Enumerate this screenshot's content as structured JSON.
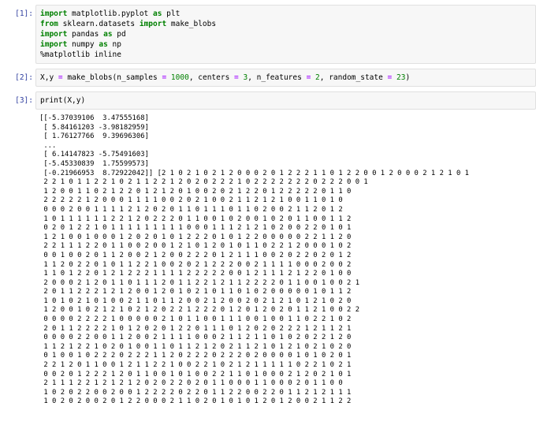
{
  "cells": [
    {
      "prompt": "[1]:",
      "lines": [
        [
          [
            "kw",
            "import"
          ],
          [
            "fn",
            " matplotlib.pyplot "
          ],
          [
            "kw",
            "as"
          ],
          [
            "fn",
            " plt"
          ]
        ],
        [
          [
            "kw",
            "from"
          ],
          [
            "fn",
            " sklearn.datasets "
          ],
          [
            "kw",
            "import"
          ],
          [
            "fn",
            " make_blobs"
          ]
        ],
        [
          [
            "kw",
            "import"
          ],
          [
            "fn",
            " pandas "
          ],
          [
            "kw",
            "as"
          ],
          [
            "fn",
            " pd"
          ]
        ],
        [
          [
            "kw",
            "import"
          ],
          [
            "fn",
            " numpy "
          ],
          [
            "kw",
            "as"
          ],
          [
            "fn",
            " np"
          ]
        ],
        [
          [
            "mag",
            "%matplotlib inline"
          ]
        ]
      ]
    },
    {
      "prompt": "[2]:",
      "lines": [
        [
          [
            "fn",
            "X,y "
          ],
          [
            "op",
            "="
          ],
          [
            "fn",
            " make_blobs(n_samples "
          ],
          [
            "op",
            "="
          ],
          [
            "num",
            " 1000"
          ],
          [
            "fn",
            ", centers "
          ],
          [
            "op",
            "="
          ],
          [
            "num",
            " 3"
          ],
          [
            "fn",
            ", n_features "
          ],
          [
            "op",
            "="
          ],
          [
            "num",
            " 2"
          ],
          [
            "fn",
            ", random_state "
          ],
          [
            "op",
            "="
          ],
          [
            "num",
            " 23"
          ],
          [
            "fn",
            ")"
          ]
        ]
      ]
    },
    {
      "prompt": "[3]:",
      "lines": [
        [
          [
            "fn",
            "print(X,y)"
          ]
        ]
      ]
    }
  ],
  "output_lines": [
    "[[-5.37039106  3.47555168]",
    " [ 5.84161203 -3.98182959]",
    " [ 1.76127766  9.39696306]",
    " ...",
    " [ 6.14147823 -5.75491603]",
    " [-5.45330839  1.75599573]",
    " [-0.21966953  8.72922042]] [2 1 0 2 1 0 2 1 2 0 0 0 2 0 1 2 2 2 1 1 0 1 2 2 0 0 1 2 0 0 0 2 1 2 1 0 1",
    " 2 2 1 0 1 1 2 2 1 0 2 1 1 2 2 1 2 0 2 0 2 2 2 1 0 2 2 2 2 2 2 2 0 2 2 2 0 0 1",
    " 1 2 0 0 1 1 0 2 1 2 2 0 1 2 1 2 0 1 0 0 2 0 2 1 2 2 0 1 2 2 2 2 2 0 1 1 0",
    " 2 2 2 2 2 1 2 0 0 0 1 1 1 1 0 0 2 0 2 1 0 0 2 1 1 2 1 2 1 0 0 1 1 0 1 0",
    " 0 0 0 2 0 0 1 1 1 1 2 1 2 0 2 0 1 1 0 1 1 1 0 1 1 0 2 0 0 2 1 1 2 0 1 2",
    " 1 0 1 1 1 1 1 1 2 2 1 2 0 2 2 2 0 1 1 0 0 1 0 2 0 0 1 0 2 0 1 1 0 0 1 1 2",
    " 0 2 0 1 2 2 1 0 1 1 1 1 1 1 1 1 1 0 0 0 1 1 1 2 1 2 1 0 2 0 0 2 2 0 1 0 1",
    " 1 2 1 0 0 1 0 0 0 1 2 0 2 0 1 0 1 2 2 2 0 1 0 1 2 2 0 0 0 0 0 2 2 1 1 2 0",
    " 2 2 1 1 1 2 2 0 1 1 0 0 2 0 0 1 2 1 0 1 2 0 1 0 1 1 0 2 2 1 2 0 0 0 1 0 2",
    " 0 0 1 0 0 2 0 1 1 2 0 0 2 1 2 0 0 2 2 2 0 1 2 1 1 1 0 0 2 0 2 2 0 2 0 1 2",
    " 1 1 2 0 2 2 0 1 0 1 1 2 2 1 0 0 2 0 2 1 2 2 2 0 0 2 1 1 1 1 0 0 0 2 0 0 2",
    " 1 1 0 1 2 2 0 1 2 1 2 2 2 1 1 1 1 2 2 2 2 2 0 0 1 2 1 1 1 2 1 2 2 0 1 0 0",
    " 2 0 0 0 2 1 2 0 1 1 0 1 1 1 2 0 1 1 2 2 1 2 1 1 2 2 2 2 0 1 1 0 0 1 0 0 2 1",
    " 2 0 1 1 2 2 2 1 2 1 2 0 0 1 2 0 1 0 2 1 0 1 1 0 1 0 2 0 0 0 0 0 1 0 1 1 2",
    " 1 0 1 0 2 1 0 1 0 0 2 1 1 0 1 1 2 0 0 2 1 2 0 0 2 0 2 1 2 1 0 1 2 1 0 2 0",
    " 1 2 0 0 1 0 2 1 2 1 0 2 1 2 0 2 2 1 2 2 2 0 1 2 0 1 2 0 2 0 1 1 2 1 0 0 2 2",
    " 0 0 0 0 2 2 2 2 1 0 0 0 0 0 2 1 0 1 1 0 0 1 1 1 0 0 1 0 0 1 1 0 2 2 1 0 2",
    " 2 0 1 1 2 2 2 2 1 0 1 2 0 2 0 1 2 2 0 1 1 1 0 1 2 0 2 0 2 2 2 1 2 1 1 2 1",
    " 0 0 0 0 2 2 0 0 1 1 2 0 0 2 1 1 1 1 0 0 0 2 1 1 2 1 1 0 1 0 2 0 2 2 1 2 0",
    " 1 1 2 1 2 2 1 0 2 0 1 0 0 1 1 0 1 1 2 1 2 0 2 1 1 2 1 0 1 2 1 0 2 1 0 2 0",
    " 0 1 0 0 1 0 2 2 2 0 2 2 2 1 1 2 0 2 2 2 0 2 2 2 0 2 0 0 0 0 1 0 1 0 2 0 1",
    " 2 2 1 2 0 1 1 0 0 1 2 1 1 2 2 1 0 0 2 2 1 0 2 1 2 1 1 1 1 1 0 2 2 1 0 2 1",
    " 0 0 2 0 1 2 2 2 1 2 0 1 1 0 0 1 0 1 0 0 2 2 1 1 0 1 0 0 0 2 1 2 0 2 1 0 1",
    " 2 1 1 1 2 2 1 2 1 2 1 2 0 2 0 2 2 0 2 0 1 1 0 0 0 1 1 0 0 0 2 0 1 1 0 0",
    " 1 0 2 0 2 2 0 0 2 0 0 1 2 2 2 2 0 2 2 0 1 1 2 2 0 0 2 2 0 1 1 2 1 2 1 1 1",
    " 1 0 2 0 2 0 0 2 0 1 2 2 0 0 0 2 1 1 0 2 0 1 0 1 0 1 2 0 1 2 0 0 2 1 1 2 2"
  ]
}
